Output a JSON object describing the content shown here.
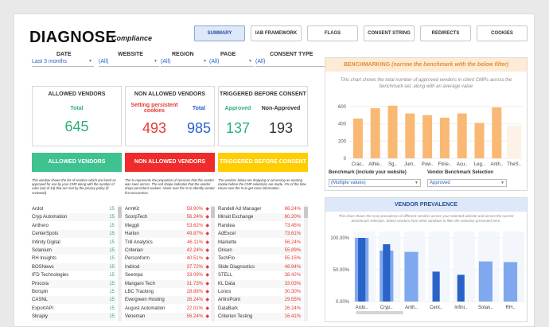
{
  "header": {
    "title": "DIAGNOSE",
    "subtitle": "Compliance"
  },
  "tabs": [
    "SUMMARY",
    "IAB FRAMEWORK",
    "FLAGS",
    "CONSENT STRING",
    "REDIRECTS",
    "COOKIES"
  ],
  "filters": [
    {
      "label": "DATE",
      "value": "Last 3 months"
    },
    {
      "label": "WEBSITE",
      "value": "(All)"
    },
    {
      "label": "REGION",
      "value": "(All)"
    },
    {
      "label": "PAGE",
      "value": "(All)"
    },
    {
      "label": "CONSENT TYPE",
      "value": "(All)"
    }
  ],
  "cards": {
    "allowed": {
      "title": "ALLOWED VENDORS",
      "label": "Total",
      "value": "645"
    },
    "non_allowed": {
      "title": "NON ALLOWED VENDORS",
      "label1": "Setting persistent cookies",
      "value1": "493",
      "label2": "Total",
      "value2": "985"
    },
    "triggered": {
      "title": "TRIGGERED BEFORE CONSENT",
      "label1": "Approved",
      "value1": "137",
      "label2": "Non-Approved",
      "value2": "193"
    }
  },
  "colors": {
    "green": "#3ec28f",
    "red": "#ef2b2b",
    "yellow": "#ffce00",
    "blue": "#2a62c8",
    "orange": "#f9b874"
  },
  "banners": {
    "allowed": "ALLOWED VENDORS",
    "non_allowed": "NON ALLOWED VENDORS",
    "triggered": "TRIGGERED BEFORE CONSENT"
  },
  "descriptions": {
    "allowed": "This window shows the list of vendors which are listed as approved for use by your CMP along with the number of rules (out of 16) that are met by the privacy policy (if reviewed).",
    "non_allowed": "The % represents the proportion of sessions that this vendor was seen across. The red shape indicates that the vendor drops persistent cookies. Hover over the % to identify vendor first occurrence.",
    "triggered": "The vendors below are dropping or accessing an existing cookie before the CMP selections are made. X% of the time. Hover over the % to get more information."
  },
  "allowed_list": [
    {
      "name": "Ardot",
      "value": "15"
    },
    {
      "name": "Cryp Automation",
      "value": "15"
    },
    {
      "name": "Anthero",
      "value": "15"
    },
    {
      "name": "CenterSpots",
      "value": "15"
    },
    {
      "name": "Infinity Digital",
      "value": "15"
    },
    {
      "name": "Solanium",
      "value": "15"
    },
    {
      "name": "RH Insights",
      "value": "15"
    },
    {
      "name": "BOSNews",
      "value": "15"
    },
    {
      "name": "IFD Technologies",
      "value": "15"
    },
    {
      "name": "Procora",
      "value": "15"
    },
    {
      "name": "Borspin",
      "value": "15"
    },
    {
      "name": "CASNL",
      "value": "15"
    },
    {
      "name": "ExportAPI",
      "value": "15"
    },
    {
      "name": "Skraply",
      "value": "15"
    }
  ],
  "non_allowed_list": [
    {
      "name": "ArmKit",
      "value": "59.90%"
    },
    {
      "name": "ScorpTech",
      "value": "56.24%"
    },
    {
      "name": "Meggit",
      "value": "53.62%"
    },
    {
      "name": "Harlon",
      "value": "49.87%"
    },
    {
      "name": "Trill Analytics",
      "value": "46.11%"
    },
    {
      "name": "Criterian",
      "value": "42.24%"
    },
    {
      "name": "Personform",
      "value": "40.51%"
    },
    {
      "name": "Indirod",
      "value": "37.72%"
    },
    {
      "name": "Seempa",
      "value": "33.09%"
    },
    {
      "name": "Mangaro Tech",
      "value": "31.73%"
    },
    {
      "name": "LBC Tracking",
      "value": "28.88%"
    },
    {
      "name": "Evergreen Hosting",
      "value": "26.24%"
    },
    {
      "name": "August Automation",
      "value": "22.01%"
    },
    {
      "name": "Veneman",
      "value": "56.24%"
    }
  ],
  "triggered_list": [
    {
      "name": "Randell Ad Manager",
      "value": "86.24%"
    },
    {
      "name": "Minuit Exchange",
      "value": "80.20%"
    },
    {
      "name": "Randea",
      "value": "73.45%"
    },
    {
      "name": "AdExcel",
      "value": "73.61%"
    },
    {
      "name": "Markette",
      "value": "56.24%"
    },
    {
      "name": "Orison",
      "value": "55.89%"
    },
    {
      "name": "TechFlo",
      "value": "55.15%"
    },
    {
      "name": "Slide Diagnostics",
      "value": "46.94%"
    },
    {
      "name": "STELL",
      "value": "38.42%"
    },
    {
      "name": "KL Data",
      "value": "33.03%"
    },
    {
      "name": "Lonos",
      "value": "30.30%"
    },
    {
      "name": "ArtiroPoint",
      "value": "29.55%"
    },
    {
      "name": "DataBark",
      "value": "26.24%"
    },
    {
      "name": "Criterion Testing",
      "value": "16.41%"
    }
  ],
  "benchmarking": {
    "title_bold": "BENCHMARKING",
    "title_italic": "(narrow the benchmark with the below filter)",
    "description": "This chart shows the total number of approved vendors in client CMPs across the benchmark set, along with an average value",
    "bench_label": "Benchmark (include your website)",
    "bench_value": "(Multiple values)",
    "vendor_label": "Vendor Benchmark Selection",
    "vendor_value": "Approved"
  },
  "prevalence": {
    "title": "VENDOR PREVALENCE",
    "description": "This chart shows the scan prevalence of different vendors across your selected website and across the current benchmark selection. Select vendors from other windows to filter the selection presented here."
  },
  "chart_data": [
    {
      "type": "bar",
      "categories": [
        "Crac..",
        "Athle..",
        "Sg..",
        "Jum..",
        "Pow..",
        "Fitne..",
        "Acu..",
        "Leg..",
        "Anth..",
        "TheS.."
      ],
      "values": [
        460,
        580,
        610,
        520,
        500,
        470,
        520,
        410,
        590,
        0
      ],
      "ylim": [
        0,
        700
      ],
      "yticks": [
        "0",
        "200",
        "400",
        "600"
      ],
      "grid": true
    },
    {
      "type": "bar",
      "categories": [
        "Ardo..",
        "Cryp..",
        "Anth..",
        "Cent..",
        "Infini..",
        "Solan..",
        "RH.."
      ],
      "series": [
        {
          "values": [
            100,
            80,
            78,
            0,
            0,
            63,
            62
          ]
        },
        {
          "values": [
            100,
            90,
            0,
            47,
            42,
            0,
            0
          ]
        }
      ],
      "ylim": [
        0,
        110
      ],
      "yticks": [
        "0.00%",
        "50.00%",
        "100.00%"
      ],
      "grid": true
    }
  ]
}
